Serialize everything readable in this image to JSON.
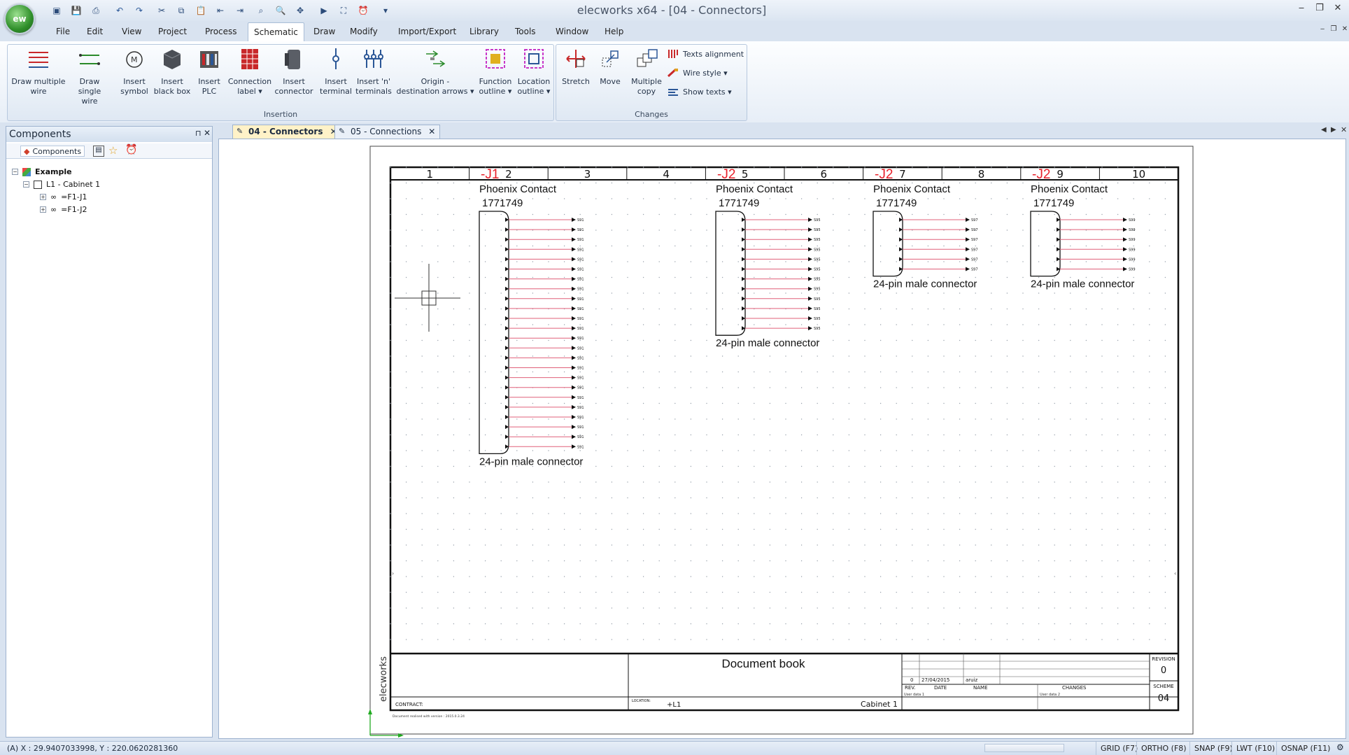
{
  "app": {
    "logo_text": "ew",
    "title": "elecworks x64 - [04 - Connectors]",
    "quick_access_icons": [
      "new-icon",
      "save-icon",
      "print-icon",
      "undo-icon",
      "redo-icon",
      "cut-icon",
      "copy-icon",
      "paste-icon",
      "import-icon",
      "export-icon",
      "zoom-window-icon",
      "zoom-icon",
      "pan-icon",
      "run-icon",
      "binoculars-icon",
      "bell-icon",
      "dropdown-icon"
    ]
  },
  "menu": {
    "items": [
      "File",
      "Edit",
      "View",
      "Project",
      "Process",
      "Schematic",
      "Draw",
      "Modify",
      "Import/Export",
      "Library",
      "Tools",
      "Window",
      "Help"
    ],
    "active": "Schematic"
  },
  "ribbon": {
    "insertion": {
      "label": "Insertion",
      "buttons": [
        {
          "l1": "Draw multiple",
          "l2": "wire"
        },
        {
          "l1": "Draw single",
          "l2": "wire"
        },
        {
          "l1": "Insert",
          "l2": "symbol"
        },
        {
          "l1": "Insert",
          "l2": "black box"
        },
        {
          "l1": "Insert",
          "l2": "PLC"
        },
        {
          "l1": "Connection",
          "l2": "label ▾"
        },
        {
          "l1": "Insert",
          "l2": "connector"
        },
        {
          "l1": "Insert",
          "l2": "terminal"
        },
        {
          "l1": "Insert 'n'",
          "l2": "terminals"
        },
        {
          "l1": "Origin -",
          "l2": "destination arrows ▾"
        },
        {
          "l1": "Function",
          "l2": "outline ▾"
        },
        {
          "l1": "Location",
          "l2": "outline ▾"
        }
      ]
    },
    "changes": {
      "label": "Changes",
      "buttons": [
        {
          "l1": "Stretch",
          "l2": ""
        },
        {
          "l1": "Move",
          "l2": ""
        },
        {
          "l1": "Multiple",
          "l2": "copy"
        }
      ],
      "small": [
        "Texts alignment",
        "Wire style ▾",
        "Show texts ▾"
      ]
    }
  },
  "components_panel": {
    "title": "Components",
    "tab": "Components",
    "tree": {
      "root": "Example",
      "cabinet": "L1 - Cabinet 1",
      "children": [
        "=F1-J1",
        "=F1-J2"
      ]
    }
  },
  "doc_tabs": [
    "04 - Connectors",
    "05 - Connections"
  ],
  "drawing": {
    "columns": [
      "1",
      "2",
      "3",
      "4",
      "5",
      "6",
      "7",
      "8",
      "9",
      "10"
    ],
    "connectors": [
      {
        "tag": "-J1",
        "maker": "Phoenix Contact",
        "ref": "1771749",
        "desc": "24-pin male connector",
        "pins": 24,
        "wire_label": "S91"
      },
      {
        "tag": "-J2",
        "maker": "Phoenix Contact",
        "ref": "1771749",
        "desc": "24-pin male connector",
        "pins": 12,
        "wire_label": "S95"
      },
      {
        "tag": "-J2",
        "maker": "Phoenix Contact",
        "ref": "1771749",
        "desc": "24-pin male connector",
        "pins": 6,
        "wire_label": "S97"
      },
      {
        "tag": "-J2",
        "maker": "Phoenix Contact",
        "ref": "1771749",
        "desc": "24-pin male connector",
        "pins": 6,
        "wire_label": "S99"
      }
    ],
    "titleblock": {
      "title": "Document book",
      "brand": "elecworks",
      "contract_label": "CONTRACT:",
      "location_label": "LOCATION:",
      "location_value": "+L1",
      "cabinet": "Cabinet 1",
      "rev_value": "0",
      "date_value": "27/04/2015",
      "name_value": "aruiz",
      "rev_hdr": "REV.",
      "date_hdr": "DATE",
      "name_hdr": "NAME",
      "changes_hdr": "CHANGES",
      "user1": "User data 1",
      "user2": "User data 2",
      "revision_label": "REVISION",
      "revision_value": "0",
      "scheme_label": "SCHEME",
      "scheme_value": "04",
      "version_note": "Document realised with version : 2015.0.3.24"
    }
  },
  "status": {
    "coords": "(A) X : 29.9407033998, Y : 220.0620281360",
    "toggles": [
      "GRID (F7)",
      "ORTHO (F8)",
      "SNAP (F9)",
      "LWT (F10)",
      "OSNAP (F11)"
    ]
  },
  "colors": {
    "accent": "#2b5797",
    "wire": "#e0607a",
    "tag": "#e8202a"
  }
}
